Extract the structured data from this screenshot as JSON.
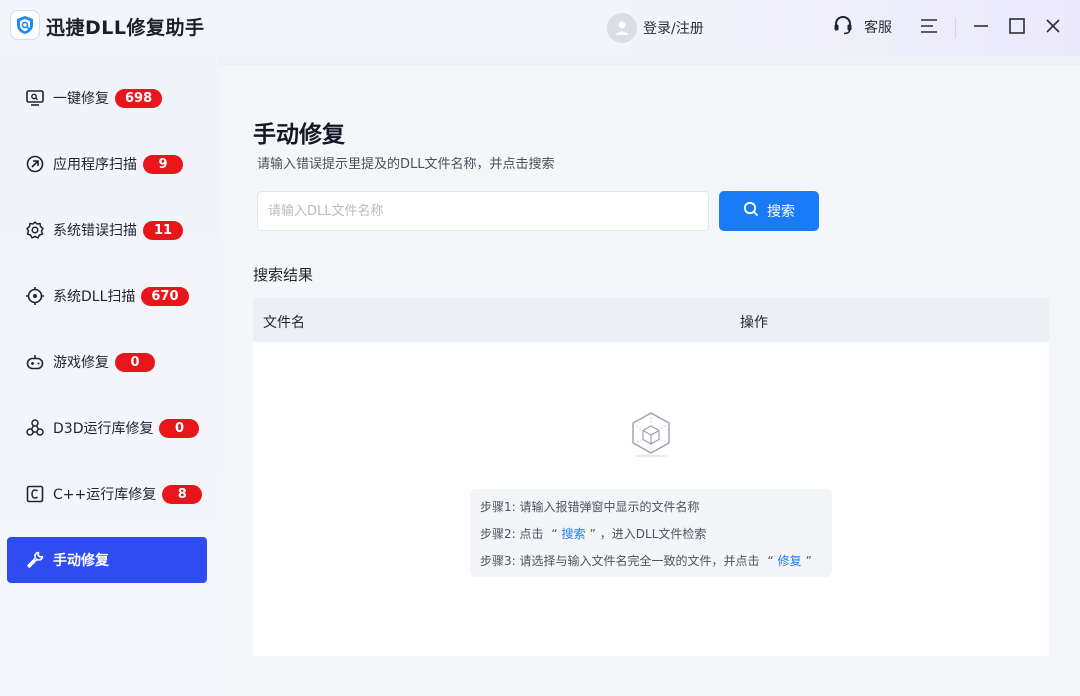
{
  "app": {
    "title": "迅捷DLL修复助手",
    "login_label": "登录/注册",
    "service_label": "客服"
  },
  "colors": {
    "accent": "#2f4cf2",
    "button_blue": "#1a7bf6",
    "badge_red": "#e8151b"
  },
  "sidebar": {
    "items": [
      {
        "label": "一键修复",
        "badge": "698",
        "icon": "monitor-repair-icon"
      },
      {
        "label": "应用程序扫描",
        "badge": "9",
        "icon": "app-scan-icon"
      },
      {
        "label": "系统错误扫描",
        "badge": "11",
        "icon": "gear-icon"
      },
      {
        "label": "系统DLL扫描",
        "badge": "670",
        "icon": "target-icon"
      },
      {
        "label": "游戏修复",
        "badge": "0",
        "icon": "gamepad-icon"
      },
      {
        "label": "D3D运行库修复",
        "badge": "0",
        "icon": "d3d-nodes-icon"
      },
      {
        "label": "C++运行库修复",
        "badge": "8",
        "icon": "c-box-icon"
      },
      {
        "label": "手动修复",
        "icon": "wrench-icon",
        "active": true
      }
    ]
  },
  "main": {
    "title": "手动修复",
    "subtitle": "请输入错误提示里提及的DLL文件名称，并点击搜索",
    "search": {
      "placeholder": "请输入DLL文件名称",
      "value": "",
      "button_label": "搜索"
    },
    "results_title": "搜索结果",
    "table": {
      "columns": [
        "文件名",
        "操作"
      ],
      "rows": []
    },
    "guide": {
      "step1": "步骤1: 请输入报错弹窗中显示的文件名称",
      "step2_prefix": "步骤2: 点击",
      "step2_link": "搜索",
      "step2_suffix": "，进入DLL文件检索",
      "step3_prefix": "步骤3: 请选择与输入文件名完全一致的文件，并点击",
      "step3_link": "修复",
      "quote_open": "“",
      "quote_close": "”"
    }
  }
}
